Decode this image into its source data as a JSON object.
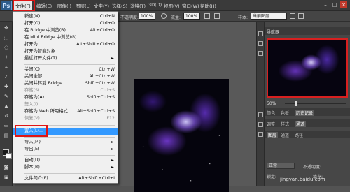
{
  "app": {
    "logo": "Ps"
  },
  "menubar": {
    "items": [
      {
        "label": "文件(F)",
        "active": true
      },
      {
        "label": "编辑(E)"
      },
      {
        "label": "图像(I)"
      },
      {
        "label": "图层(L)"
      },
      {
        "label": "文字(Y)"
      },
      {
        "label": "选择(S)"
      },
      {
        "label": "滤镜(T)"
      },
      {
        "label": "3D(D)"
      },
      {
        "label": "视图(V)"
      },
      {
        "label": "窗口(W)"
      },
      {
        "label": "帮助(H)"
      }
    ],
    "window_controls": [
      "–",
      "□",
      "×"
    ]
  },
  "options_bar": {
    "opacity_label": "不透明度:",
    "opacity_value": "100%",
    "flow_label": "流量:",
    "flow_value": "100%",
    "sample_label": "样本:",
    "sample_value": "当前图层"
  },
  "file_menu": {
    "items": [
      {
        "label": "新建(N)...",
        "shortcut": "Ctrl+N"
      },
      {
        "label": "打开(O)...",
        "shortcut": "Ctrl+O"
      },
      {
        "label": "在 Bridge 中浏览(B)...",
        "shortcut": "Alt+Ctrl+O"
      },
      {
        "label": "在 Mini Bridge 中浏览(G)..."
      },
      {
        "label": "打开为...",
        "shortcut": "Alt+Shift+Ctrl+O"
      },
      {
        "label": "打开为智能对象..."
      },
      {
        "label": "最近打开文件(T)",
        "submenu": true
      },
      {
        "label": "关闭(C)",
        "shortcut": "Ctrl+W"
      },
      {
        "label": "关闭全部",
        "shortcut": "Alt+Ctrl+W"
      },
      {
        "label": "关闭并转到 Bridge...",
        "shortcut": "Shift+Ctrl+W"
      },
      {
        "label": "存储(S)",
        "shortcut": "Ctrl+S",
        "disabled": true
      },
      {
        "label": "存储为(A)...",
        "shortcut": "Shift+Ctrl+S"
      },
      {
        "label": "签入(I)...",
        "disabled": true
      },
      {
        "label": "存储为 Web 所用格式...",
        "shortcut": "Alt+Shift+Ctrl+S"
      },
      {
        "label": "恢复(V)",
        "shortcut": "F12",
        "disabled": true
      },
      {
        "label": "置入(L)...",
        "highlight": true
      },
      {
        "label": "导入(M)",
        "submenu": true
      },
      {
        "label": "导出(E)",
        "submenu": true
      },
      {
        "label": "自动(U)",
        "submenu": true
      },
      {
        "label": "脚本(R)",
        "submenu": true
      },
      {
        "label": "文件简介(F)...",
        "shortcut": "Alt+Shift+Ctrl+I"
      }
    ]
  },
  "navigator": {
    "tab": "导航器",
    "zoom": "50%"
  },
  "panel_tabs_1": [
    "颜色",
    "色板",
    "历史记录"
  ],
  "panel_tabs_2": [
    "调整",
    "样式",
    "通道"
  ],
  "panel_tabs_3": [
    "图层",
    "通道",
    "路径"
  ],
  "layers": {
    "blend_mode": "正常",
    "opacity_label": "不透明度:",
    "fill_label": "填充:",
    "lock_label": "锁定:"
  },
  "watermark": "jingyan.baidu.com",
  "colors": {
    "highlight": "#3399ff",
    "annotation_red": "#e01515"
  }
}
